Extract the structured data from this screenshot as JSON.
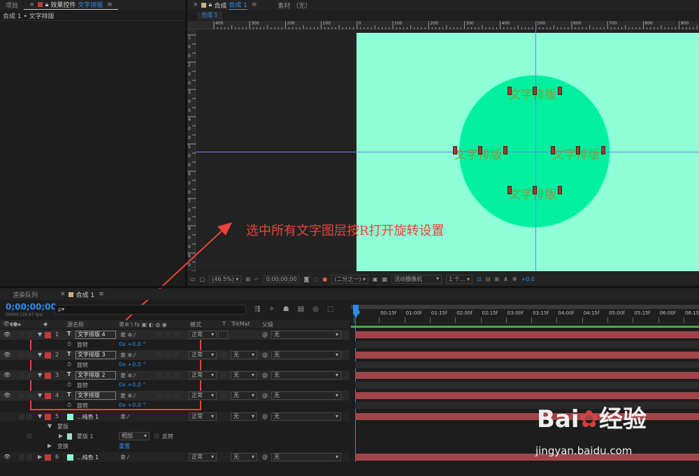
{
  "top_left_tabs": {
    "project": "项目",
    "effect_controls_prefix": "效果控件",
    "effect_controls_layer": "文字排版"
  },
  "top_left_sub": "合成 1 • 文字排版",
  "comp_tabs": {
    "comp_prefix": "合成",
    "comp_name": "合成 1",
    "footage": "素材 （无）",
    "sub_tab": "合成 1"
  },
  "ruler_h_labels": [
    "400",
    "300",
    "200",
    "100",
    "0",
    "100",
    "200",
    "300",
    "400",
    "500",
    "600",
    "700",
    "800",
    "900"
  ],
  "ruler_v_labels": [
    "1",
    "0",
    "0",
    "2",
    "0",
    "0",
    "3",
    "0",
    "0",
    "4",
    "0",
    "0",
    "5",
    "0",
    "0",
    "6",
    "0",
    "0",
    "7",
    "0",
    "0",
    "8",
    "0",
    "0",
    "9",
    "0",
    "0"
  ],
  "text_layers": [
    "文字排版",
    "文字排版",
    "文字排版",
    "文字排版"
  ],
  "viewer_toolbar": {
    "zoom": "(46.5%)",
    "timecode": "0;00;00;00",
    "resolution": "(二分之一)",
    "camera": "活动摄像机",
    "views": "1 个...",
    "exposure": "+0.0"
  },
  "annotation": "选中所有文字图层按R打开旋转设置",
  "timeline_tabs": {
    "render_queue": "渲染队列",
    "comp": "合成 1"
  },
  "timecode": "0;00;00;00",
  "timecode_sub": "00000 (29.97 fps)",
  "search_placeholder": "ρ▾",
  "columns": {
    "source": "源名称",
    "mode": "模式",
    "t": "T",
    "trkmat": "TrkMat",
    "parent": "父级"
  },
  "time_labels": [
    "0f",
    "00:15f",
    "01:00f",
    "01:15f",
    "02:00f",
    "02:15f",
    "03:00f",
    "03:15f",
    "04:00f",
    "04:15f",
    "05:00f",
    "05:15f",
    "06:00f",
    "06:15f"
  ],
  "layers": [
    {
      "num": "1",
      "type": "T",
      "name": "文字排版 4",
      "mode": "正常",
      "trkmat": "",
      "parent": "无",
      "prop": "旋转",
      "value": "0x +0.0 °"
    },
    {
      "num": "2",
      "type": "T",
      "name": "文字排版 3",
      "mode": "正常",
      "trkmat": "无",
      "parent": "无",
      "prop": "旋转",
      "value": "0x +0.0 °"
    },
    {
      "num": "3",
      "type": "T",
      "name": "文字排版 2",
      "mode": "正常",
      "trkmat": "无",
      "parent": "无",
      "prop": "旋转",
      "value": "0x +0.0 °"
    },
    {
      "num": "4",
      "type": "T",
      "name": "文字排版",
      "mode": "正常",
      "trkmat": "无",
      "parent": "无",
      "prop": "旋转",
      "value": "0x +0.0 °"
    }
  ],
  "layer5": {
    "num": "5",
    "name": "...纯色 1",
    "mode": "正常",
    "trkmat": "无",
    "parent": "无",
    "mask_group": "蒙版",
    "mask": "蒙版 1",
    "mask_mode": "相加",
    "invert": "反转",
    "transform": "变换",
    "reset": "重置"
  },
  "layer6": {
    "num": "6",
    "name": "...纯色 1",
    "mode": "正常",
    "trkmat": "无",
    "parent": "无"
  },
  "watermark": {
    "brand": "Bai",
    "brand2": "经验",
    "url": "jingyan.baidu.com"
  },
  "colors": {
    "canvas": "#8effd6",
    "circle": "#00f0a0",
    "accent": "#2d8ceb",
    "annotation": "#e8433a",
    "bar": "#a0454a"
  }
}
